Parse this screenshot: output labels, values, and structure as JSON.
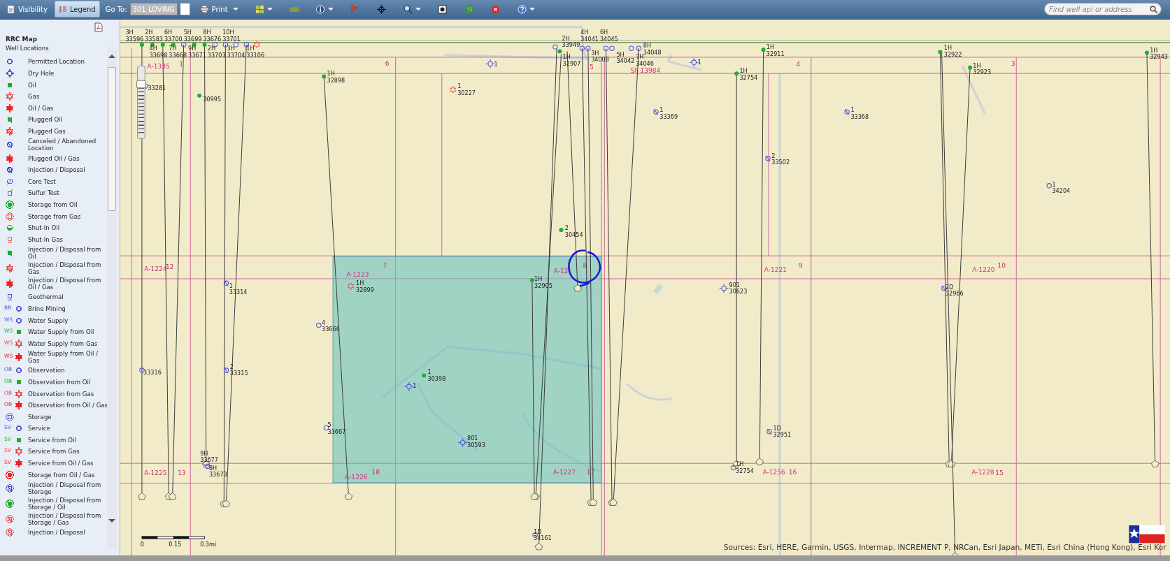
{
  "toolbar": {
    "buttons": [
      {
        "kind": "visibility",
        "label": "Visibility",
        "selected": false
      },
      {
        "kind": "legend",
        "label": "Legend",
        "selected": true
      }
    ],
    "goto": {
      "label": "Go To:",
      "value": "301 LOVING"
    },
    "print": {
      "label": "Print"
    },
    "search": {
      "placeholder": "Find well api or address"
    }
  },
  "legend": {
    "title": "RRC Map",
    "group": "Well Locations",
    "items": [
      {
        "label": "Permitted Location",
        "kind": "circle",
        "color": "#5555dd",
        "slash": false
      },
      {
        "label": "Dry Hole",
        "kind": "dry",
        "color": "#5555dd",
        "slash": false
      },
      {
        "label": "Oil",
        "kind": "dot",
        "color": "#22aa33",
        "slash": false
      },
      {
        "label": "Gas",
        "kind": "star",
        "color": "#ee4444",
        "slash": false
      },
      {
        "label": "Oil / Gas",
        "kind": "burst",
        "color": "#ee2222",
        "slash": false
      },
      {
        "label": "Plugged Oil",
        "kind": "dot",
        "color": "#22aa33",
        "slash": true
      },
      {
        "label": "Plugged Gas",
        "kind": "star",
        "color": "#ee4444",
        "slash": true
      },
      {
        "label": "Canceled / Abandoned Location",
        "kind": "circle",
        "color": "#5555dd",
        "slash": true
      },
      {
        "label": "Plugged Oil / Gas",
        "kind": "burst",
        "color": "#ee2222",
        "slash": true
      },
      {
        "label": "Injection / Disposal",
        "kind": "circle",
        "color": "#4444cc",
        "slash": true
      },
      {
        "label": "Core Test",
        "kind": "core",
        "color": "#5555dd",
        "slash": false
      },
      {
        "label": "Sulfur Test",
        "kind": "sulfur",
        "color": "#5555dd",
        "slash": false
      },
      {
        "label": "Storage from Oil",
        "kind": "target",
        "color": "#22aa33",
        "slash": false
      },
      {
        "label": "Storage from Gas",
        "kind": "ring",
        "color": "#ee4444",
        "slash": false
      },
      {
        "label": "Shut-In Oil",
        "kind": "half",
        "color": "#22aa33",
        "slash": false
      },
      {
        "label": "Shut-In Gas",
        "kind": "pin",
        "color": "#ee6666",
        "slash": false
      },
      {
        "label": "Injection / Disposal from Oil",
        "kind": "dot",
        "color": "#22aa33",
        "slash": true
      },
      {
        "label": "Injection / Disposal from Gas",
        "kind": "star",
        "color": "#ee4444",
        "slash": true
      },
      {
        "label": "Injection / Disposal from Oil / Gas",
        "kind": "burst",
        "color": "#ee2222",
        "slash": true
      },
      {
        "label": "Geothermal",
        "kind": "pin",
        "color": "#5555dd",
        "slash": false
      },
      {
        "label": "Brine Mining",
        "kind": "circle",
        "color": "#5555dd",
        "slash": false,
        "prefix": "BR"
      },
      {
        "label": "Water Supply",
        "kind": "circle",
        "color": "#5555dd",
        "slash": false,
        "prefix": "WS"
      },
      {
        "label": "Water Supply from Oil",
        "kind": "dot",
        "color": "#22aa33",
        "slash": false,
        "prefix": "WS"
      },
      {
        "label": "Water Supply from Gas",
        "kind": "star",
        "color": "#ee4444",
        "slash": false,
        "prefix": "WS"
      },
      {
        "label": "Water Supply from Oil / Gas",
        "kind": "burst",
        "color": "#ee2222",
        "slash": false,
        "prefix": "WS"
      },
      {
        "label": "Observation",
        "kind": "circle",
        "color": "#5555dd",
        "slash": false,
        "prefix": "OB"
      },
      {
        "label": "Observation from Oil",
        "kind": "dot",
        "color": "#22aa33",
        "slash": false,
        "prefix": "OB"
      },
      {
        "label": "Observation from Gas",
        "kind": "star",
        "color": "#ee4444",
        "slash": false,
        "prefix": "OB"
      },
      {
        "label": "Observation from Oil / Gas",
        "kind": "burst",
        "color": "#ee2222",
        "slash": false,
        "prefix": "OB"
      },
      {
        "label": "Storage",
        "kind": "ring",
        "color": "#5555dd",
        "slash": false
      },
      {
        "label": "Service",
        "kind": "circle",
        "color": "#5555dd",
        "slash": false,
        "prefix": "SV"
      },
      {
        "label": "Service from Oil",
        "kind": "dot",
        "color": "#22aa33",
        "slash": false,
        "prefix": "SV"
      },
      {
        "label": "Service from Gas",
        "kind": "star",
        "color": "#ee4444",
        "slash": false,
        "prefix": "SV"
      },
      {
        "label": "Service from Oil / Gas",
        "kind": "burst",
        "color": "#ee2222",
        "slash": false,
        "prefix": "SV"
      },
      {
        "label": "Storage from Oil / Gas",
        "kind": "target",
        "color": "#ee2222",
        "slash": false
      },
      {
        "label": "Injection / Disposal from Storage",
        "kind": "ring",
        "color": "#4444cc",
        "slash": true
      },
      {
        "label": "Injection / Disposal from Storage / Oil",
        "kind": "target",
        "color": "#22aa33",
        "slash": true
      },
      {
        "label": "Injection / Disposal from Storage / Gas",
        "kind": "ring",
        "color": "#ee4444",
        "slash": true
      },
      {
        "label": "Injection / Disposal",
        "kind": "ring",
        "color": "#ee4444",
        "slash": true
      }
    ]
  },
  "map": {
    "zoom_slider": {
      "level": 0.75
    },
    "wells": [
      {
        "kind": "oil",
        "name": "3H",
        "number": "33596"
      },
      {
        "kind": "oil",
        "name": "2H",
        "number": "33583"
      },
      {
        "kind": "oil",
        "name": "6H",
        "number": "33700"
      },
      {
        "kind": "oil",
        "name": "4H",
        "number": "33698"
      },
      {
        "kind": "permitted",
        "name": "5H",
        "number": "33699"
      },
      {
        "kind": "oil",
        "name": "8H",
        "number": "33676"
      },
      {
        "kind": "oil",
        "name": "7H",
        "number": "33668"
      },
      {
        "kind": "permitted",
        "name": "10H",
        "number": "33701"
      },
      {
        "kind": "permitted",
        "name": "9H",
        "number": "33671"
      },
      {
        "kind": "permitted",
        "name": "2H",
        "number": "33703"
      },
      {
        "kind": "permitted",
        "name": "3H",
        "number": "33704"
      },
      {
        "kind": "gas",
        "name": "1H",
        "number": "33106"
      },
      {
        "kind": "permitted",
        "number": "33281"
      },
      {
        "kind": "oil",
        "number": "30995"
      },
      {
        "kind": "oil",
        "name": "1H",
        "number": "32898"
      },
      {
        "kind": "gas",
        "name": "1",
        "number": "30227"
      },
      {
        "kind": "dry",
        "name": "1"
      },
      {
        "kind": "permitted",
        "name": "2H",
        "number": "33949"
      },
      {
        "kind": "oil",
        "name": "1H",
        "number": "32907"
      },
      {
        "kind": "permitted",
        "name": "4H",
        "number": "34041"
      },
      {
        "kind": "permitted",
        "name": "6H",
        "number": "34045"
      },
      {
        "kind": "permitted",
        "name": "3H",
        "number": "34008"
      },
      {
        "kind": "permitted",
        "name": "5H",
        "number": "34042"
      },
      {
        "kind": "permitted",
        "name": "8H",
        "number": "34048"
      },
      {
        "kind": "permitted",
        "name": "7H",
        "number": "34046"
      },
      {
        "kind": "dry",
        "name": "1"
      },
      {
        "kind": "oil",
        "name": "1H",
        "number": "32754"
      },
      {
        "kind": "oil",
        "name": "1H",
        "number": "32911"
      },
      {
        "kind": "oil",
        "name": "1H",
        "number": "32922"
      },
      {
        "kind": "oil",
        "name": "1H",
        "number": "32923"
      },
      {
        "kind": "oil",
        "name": "1H",
        "number": "32943"
      },
      {
        "kind": "canceled",
        "name": "1",
        "number": "33369"
      },
      {
        "kind": "canceled",
        "name": "1",
        "number": "33368"
      },
      {
        "kind": "canceled",
        "name": "2",
        "number": "33502"
      },
      {
        "kind": "permitted",
        "name": "1",
        "number": "34204"
      },
      {
        "kind": "oil",
        "name": "2",
        "number": "30454"
      },
      {
        "kind": "canceled",
        "name": "1",
        "number": "33314"
      },
      {
        "kind": "gas",
        "name": "1H",
        "number": "32899"
      },
      {
        "kind": "oil",
        "name": "1H",
        "number": "32905"
      },
      {
        "kind": "dry",
        "name": "901",
        "number": "30623"
      },
      {
        "kind": "canceled",
        "name": "2D",
        "number": "32966"
      },
      {
        "kind": "permitted",
        "name": "4",
        "number": "33666"
      },
      {
        "kind": "permitted",
        "number": "33316"
      },
      {
        "kind": "canceled",
        "name": "2",
        "number": "33315"
      },
      {
        "kind": "oil",
        "name": "1",
        "number": "30398"
      },
      {
        "kind": "dry",
        "name": "1"
      },
      {
        "kind": "permitted",
        "name": "5",
        "number": "33667"
      },
      {
        "kind": "dry",
        "name": "801",
        "number": "30593"
      },
      {
        "kind": "canceled",
        "name": "1D",
        "number": "32951"
      },
      {
        "kind": "permitted",
        "name": "9H",
        "number": "33677"
      },
      {
        "kind": "permitted",
        "name": "8H",
        "number": "33673"
      },
      {
        "kind": "permitted",
        "name": "1H",
        "number": "32754"
      },
      {
        "kind": "permitted",
        "name": "1D",
        "number": "34161"
      }
    ],
    "tract_labels": [
      {
        "kind": "abstract",
        "text": "A-1335"
      },
      {
        "kind": "section",
        "text": "1"
      },
      {
        "kind": "section",
        "text": "6"
      },
      {
        "kind": "section",
        "text": "5"
      },
      {
        "kind": "abstract",
        "text": "SF 13984"
      },
      {
        "kind": "section",
        "text": "4"
      },
      {
        "kind": "section",
        "text": "3"
      },
      {
        "kind": "abstract",
        "text": "A-1224"
      },
      {
        "kind": "section",
        "text": "12"
      },
      {
        "kind": "section",
        "text": "7"
      },
      {
        "kind": "abstract",
        "text": "A-1223"
      },
      {
        "kind": "abstract",
        "text": "A-12"
      },
      {
        "kind": "section",
        "text": "8"
      },
      {
        "kind": "abstract",
        "text": "A-1221"
      },
      {
        "kind": "section",
        "text": "9"
      },
      {
        "kind": "abstract",
        "text": "A-1220"
      },
      {
        "kind": "section",
        "text": "10"
      },
      {
        "kind": "abstract",
        "text": "A-1225"
      },
      {
        "kind": "section",
        "text": "13"
      },
      {
        "kind": "abstract",
        "text": "A-1226"
      },
      {
        "kind": "section",
        "text": "18"
      },
      {
        "kind": "abstract",
        "text": "A-1227"
      },
      {
        "kind": "section",
        "text": "17"
      },
      {
        "kind": "abstract",
        "text": "A-1256"
      },
      {
        "kind": "section",
        "text": "16"
      },
      {
        "kind": "abstract",
        "text": "A-1228"
      },
      {
        "kind": "section",
        "text": "15"
      }
    ],
    "scale_bar": {
      "ticks": [
        "0",
        "0.15",
        "0.3mi"
      ]
    },
    "attribution": "Sources: Esri, HERE, Garmin, USGS, Intermap, INCREMENT P, NRCan, Esri Japan, METI, Esri China (Hong Kong), Esri Kor"
  }
}
